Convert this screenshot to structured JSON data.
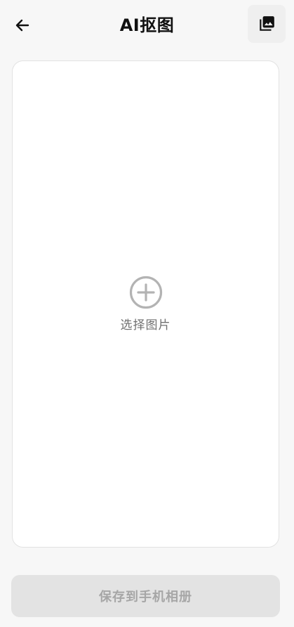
{
  "header": {
    "title": "AI抠图",
    "back_icon": "back-arrow-icon",
    "gallery_icon": "photo-library-icon"
  },
  "canvas": {
    "picker_label": "选择图片",
    "picker_icon": "add-circle-icon"
  },
  "footer": {
    "save_label": "保存到手机相册"
  },
  "colors": {
    "background": "#f7f7f7",
    "card": "#ffffff",
    "disabled_button": "#e3e3e3",
    "disabled_text": "#a6a6a6",
    "icon_gray": "#b3b3b3"
  }
}
